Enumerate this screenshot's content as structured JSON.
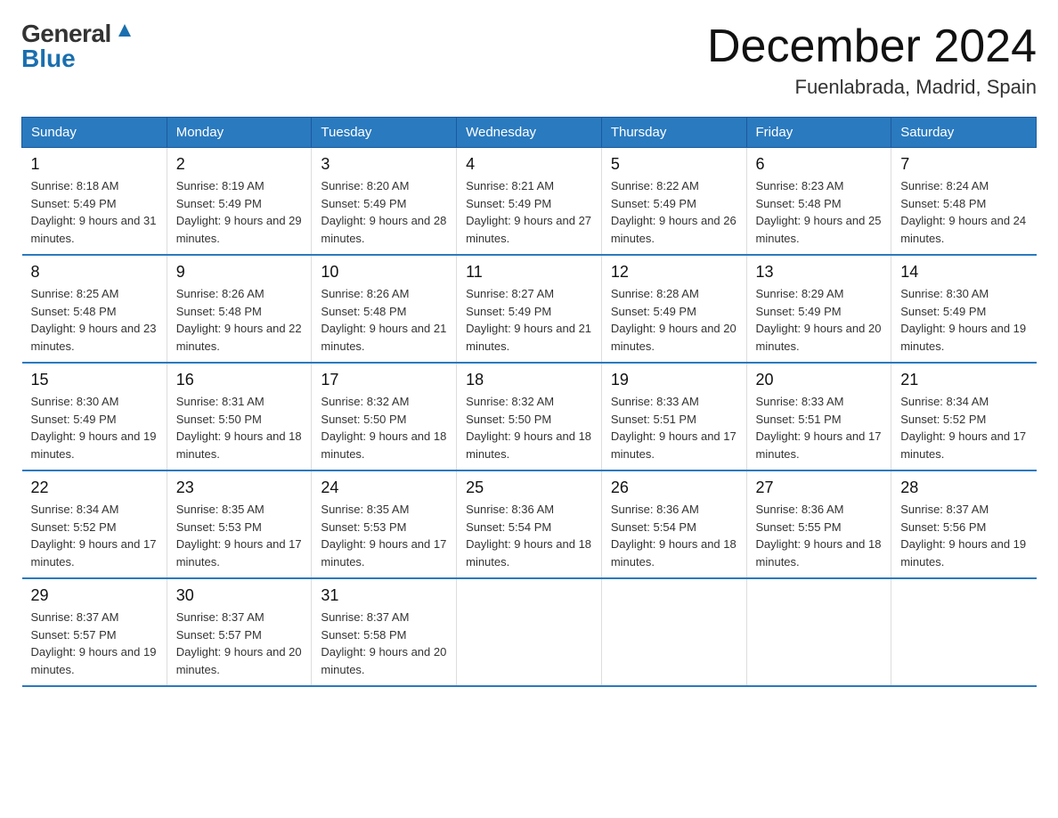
{
  "logo": {
    "general": "General",
    "blue": "Blue",
    "triangle": "▲"
  },
  "title": {
    "month": "December 2024",
    "location": "Fuenlabrada, Madrid, Spain"
  },
  "headers": [
    "Sunday",
    "Monday",
    "Tuesday",
    "Wednesday",
    "Thursday",
    "Friday",
    "Saturday"
  ],
  "weeks": [
    [
      {
        "day": "1",
        "sunrise": "8:18 AM",
        "sunset": "5:49 PM",
        "daylight": "9 hours and 31 minutes."
      },
      {
        "day": "2",
        "sunrise": "8:19 AM",
        "sunset": "5:49 PM",
        "daylight": "9 hours and 29 minutes."
      },
      {
        "day": "3",
        "sunrise": "8:20 AM",
        "sunset": "5:49 PM",
        "daylight": "9 hours and 28 minutes."
      },
      {
        "day": "4",
        "sunrise": "8:21 AM",
        "sunset": "5:49 PM",
        "daylight": "9 hours and 27 minutes."
      },
      {
        "day": "5",
        "sunrise": "8:22 AM",
        "sunset": "5:49 PM",
        "daylight": "9 hours and 26 minutes."
      },
      {
        "day": "6",
        "sunrise": "8:23 AM",
        "sunset": "5:48 PM",
        "daylight": "9 hours and 25 minutes."
      },
      {
        "day": "7",
        "sunrise": "8:24 AM",
        "sunset": "5:48 PM",
        "daylight": "9 hours and 24 minutes."
      }
    ],
    [
      {
        "day": "8",
        "sunrise": "8:25 AM",
        "sunset": "5:48 PM",
        "daylight": "9 hours and 23 minutes."
      },
      {
        "day": "9",
        "sunrise": "8:26 AM",
        "sunset": "5:48 PM",
        "daylight": "9 hours and 22 minutes."
      },
      {
        "day": "10",
        "sunrise": "8:26 AM",
        "sunset": "5:48 PM",
        "daylight": "9 hours and 21 minutes."
      },
      {
        "day": "11",
        "sunrise": "8:27 AM",
        "sunset": "5:49 PM",
        "daylight": "9 hours and 21 minutes."
      },
      {
        "day": "12",
        "sunrise": "8:28 AM",
        "sunset": "5:49 PM",
        "daylight": "9 hours and 20 minutes."
      },
      {
        "day": "13",
        "sunrise": "8:29 AM",
        "sunset": "5:49 PM",
        "daylight": "9 hours and 20 minutes."
      },
      {
        "day": "14",
        "sunrise": "8:30 AM",
        "sunset": "5:49 PM",
        "daylight": "9 hours and 19 minutes."
      }
    ],
    [
      {
        "day": "15",
        "sunrise": "8:30 AM",
        "sunset": "5:49 PM",
        "daylight": "9 hours and 19 minutes."
      },
      {
        "day": "16",
        "sunrise": "8:31 AM",
        "sunset": "5:50 PM",
        "daylight": "9 hours and 18 minutes."
      },
      {
        "day": "17",
        "sunrise": "8:32 AM",
        "sunset": "5:50 PM",
        "daylight": "9 hours and 18 minutes."
      },
      {
        "day": "18",
        "sunrise": "8:32 AM",
        "sunset": "5:50 PM",
        "daylight": "9 hours and 18 minutes."
      },
      {
        "day": "19",
        "sunrise": "8:33 AM",
        "sunset": "5:51 PM",
        "daylight": "9 hours and 17 minutes."
      },
      {
        "day": "20",
        "sunrise": "8:33 AM",
        "sunset": "5:51 PM",
        "daylight": "9 hours and 17 minutes."
      },
      {
        "day": "21",
        "sunrise": "8:34 AM",
        "sunset": "5:52 PM",
        "daylight": "9 hours and 17 minutes."
      }
    ],
    [
      {
        "day": "22",
        "sunrise": "8:34 AM",
        "sunset": "5:52 PM",
        "daylight": "9 hours and 17 minutes."
      },
      {
        "day": "23",
        "sunrise": "8:35 AM",
        "sunset": "5:53 PM",
        "daylight": "9 hours and 17 minutes."
      },
      {
        "day": "24",
        "sunrise": "8:35 AM",
        "sunset": "5:53 PM",
        "daylight": "9 hours and 17 minutes."
      },
      {
        "day": "25",
        "sunrise": "8:36 AM",
        "sunset": "5:54 PM",
        "daylight": "9 hours and 18 minutes."
      },
      {
        "day": "26",
        "sunrise": "8:36 AM",
        "sunset": "5:54 PM",
        "daylight": "9 hours and 18 minutes."
      },
      {
        "day": "27",
        "sunrise": "8:36 AM",
        "sunset": "5:55 PM",
        "daylight": "9 hours and 18 minutes."
      },
      {
        "day": "28",
        "sunrise": "8:37 AM",
        "sunset": "5:56 PM",
        "daylight": "9 hours and 19 minutes."
      }
    ],
    [
      {
        "day": "29",
        "sunrise": "8:37 AM",
        "sunset": "5:57 PM",
        "daylight": "9 hours and 19 minutes."
      },
      {
        "day": "30",
        "sunrise": "8:37 AM",
        "sunset": "5:57 PM",
        "daylight": "9 hours and 20 minutes."
      },
      {
        "day": "31",
        "sunrise": "8:37 AM",
        "sunset": "5:58 PM",
        "daylight": "9 hours and 20 minutes."
      },
      null,
      null,
      null,
      null
    ]
  ]
}
